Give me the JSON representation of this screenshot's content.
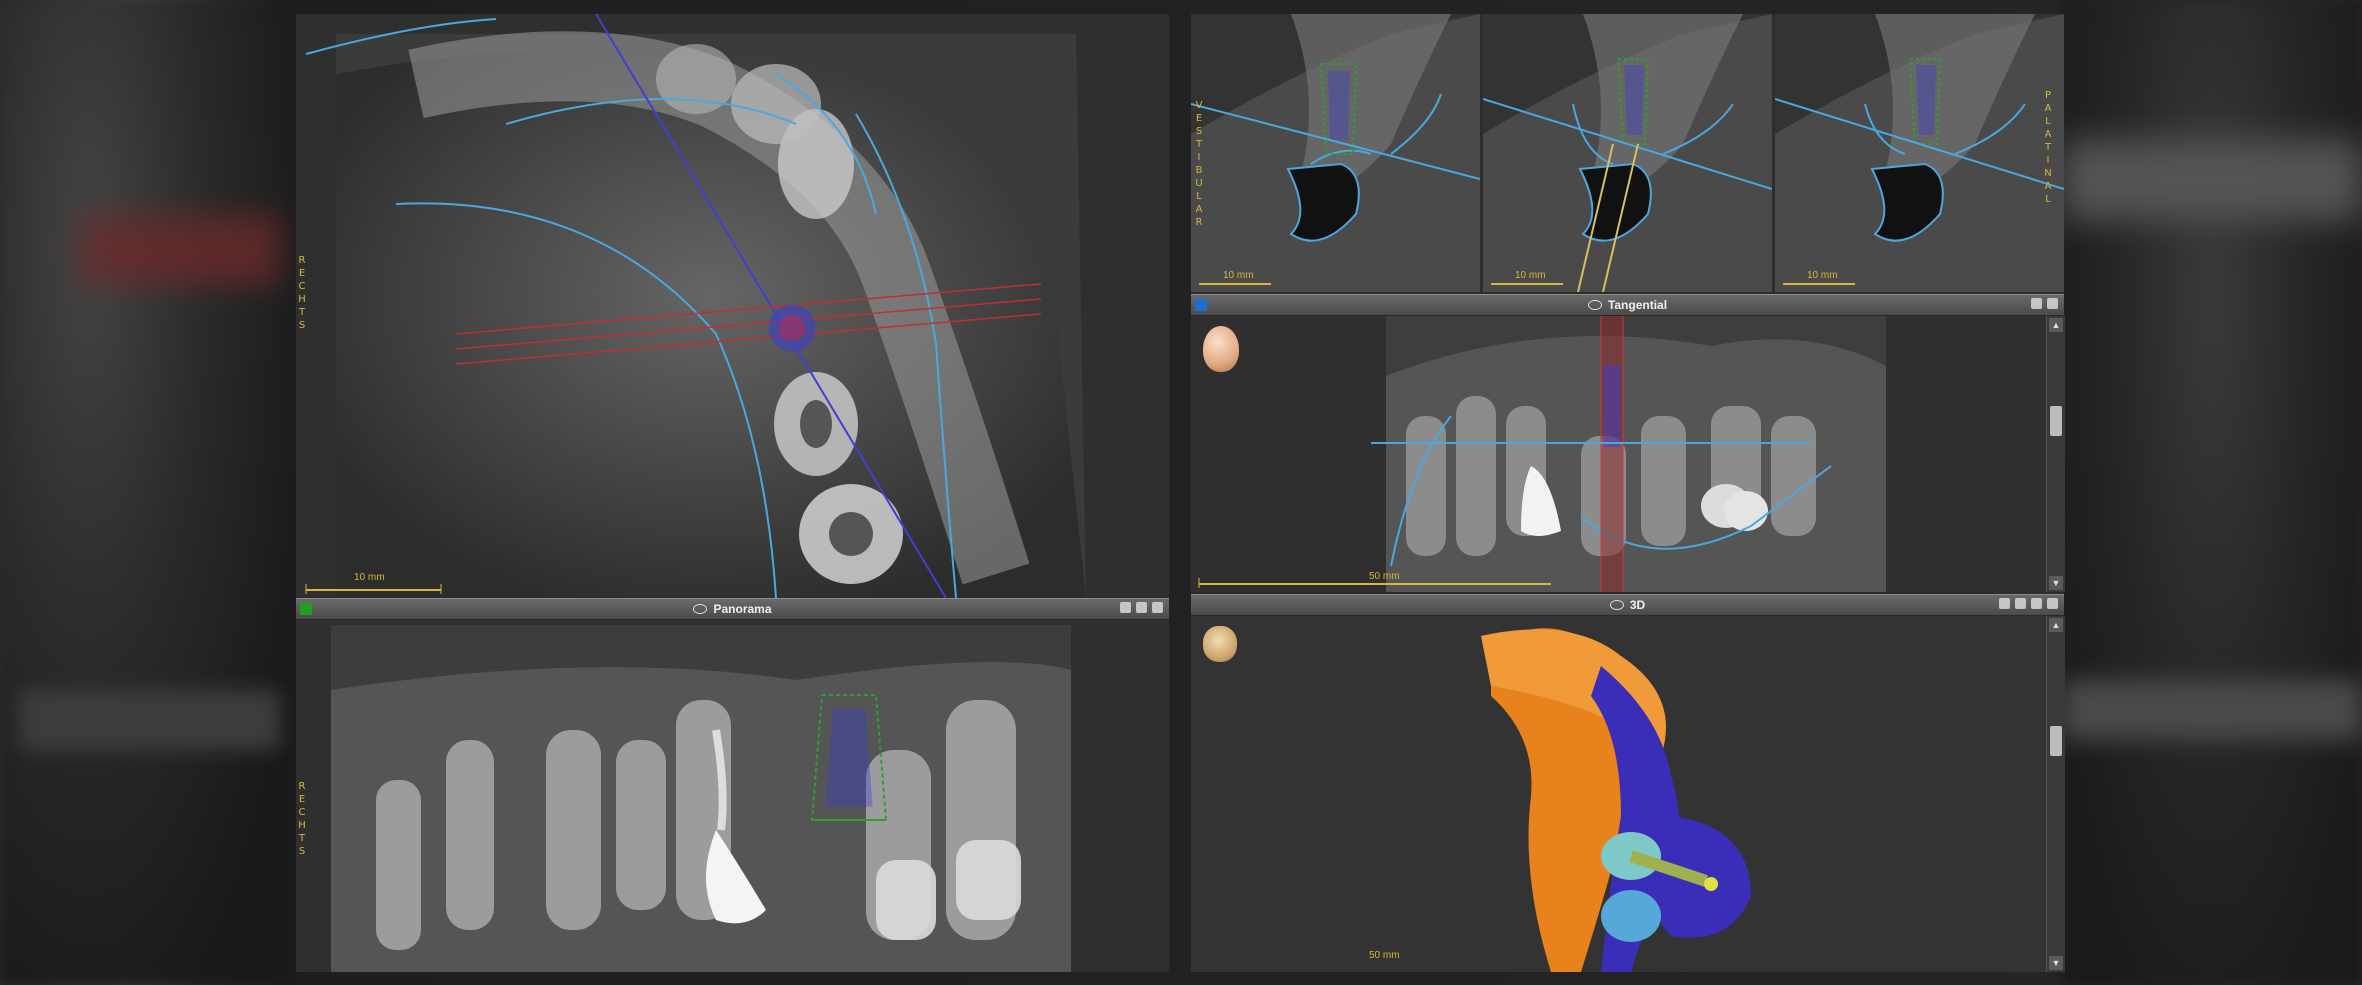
{
  "views": {
    "axial": {
      "orientation_label": "RECHTS",
      "scale_label": "10 mm"
    },
    "panorama": {
      "title": "Panorama",
      "orientation_label": "RECHTS"
    },
    "cross_sections": [
      {
        "orientation_label": "VESTIBULAR",
        "scale_label": "10 mm"
      },
      {
        "scale_label": "10 mm"
      },
      {
        "orientation_label": "PALATINAL",
        "scale_label": "10 mm"
      }
    ],
    "tangential": {
      "title": "Tangential",
      "scale_label": "50 mm"
    },
    "three_d": {
      "title": "3D",
      "scale_label": "50 mm"
    }
  },
  "colors": {
    "nerve_outline": "#4aa8e0",
    "implant": "#3b3bdc",
    "safety_zone": "#2ea02e",
    "axis_line": "#4040d0",
    "section_lines": "#c03030",
    "scale": "#d8b63b",
    "model_orange": "#e8821c",
    "model_blue": "#3a2db8"
  },
  "icons": [
    "head-3d-icon",
    "skull-icon",
    "eye-icon",
    "view-options-icon",
    "maximize-icon"
  ]
}
